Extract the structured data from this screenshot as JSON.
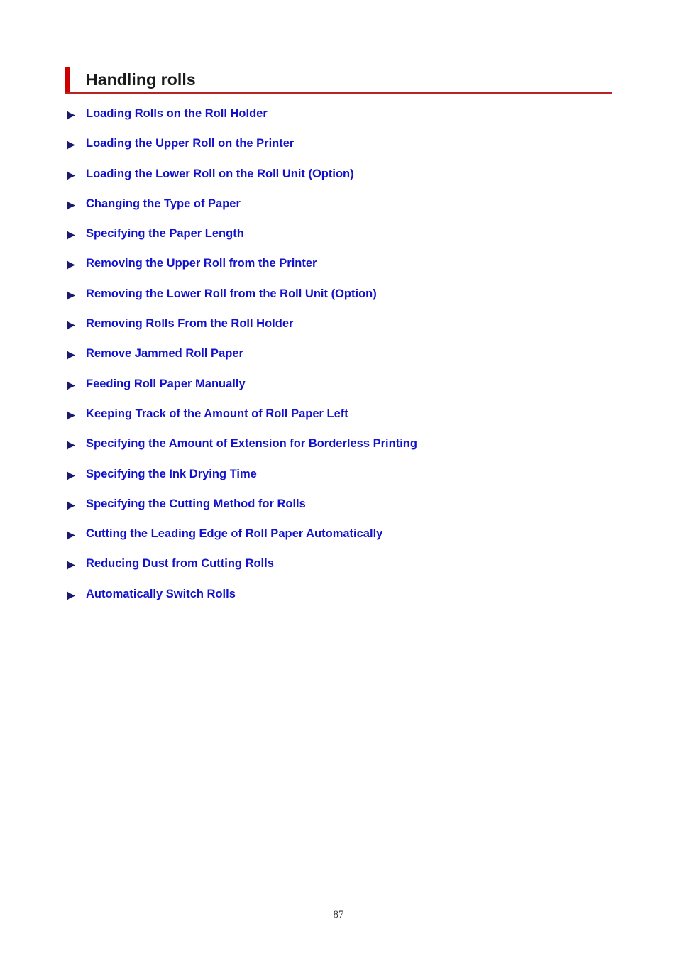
{
  "header": {
    "title": "Handling rolls",
    "accent_color": "#cc0000",
    "rule_color": "#bb2222"
  },
  "colors": {
    "link": "#1212cc",
    "bullet": "#1a1a6e",
    "title_text": "#1a1a1a",
    "background": "#ffffff"
  },
  "list": {
    "bullet_icon": "play-arrow-icon",
    "items": [
      {
        "label": "Loading Rolls on the Roll Holder"
      },
      {
        "label": "Loading the Upper Roll on the Printer"
      },
      {
        "label": "Loading the Lower Roll on the Roll Unit (Option)"
      },
      {
        "label": "Changing the Type of Paper"
      },
      {
        "label": "Specifying the Paper Length"
      },
      {
        "label": "Removing the Upper Roll from the Printer"
      },
      {
        "label": "Removing the Lower Roll from the Roll Unit (Option)"
      },
      {
        "label": "Removing Rolls From the Roll Holder"
      },
      {
        "label": "Remove Jammed Roll Paper"
      },
      {
        "label": "Feeding Roll Paper Manually"
      },
      {
        "label": "Keeping Track of the Amount of Roll Paper Left"
      },
      {
        "label": "Specifying the Amount of Extension for Borderless Printing"
      },
      {
        "label": "Specifying the Ink Drying Time"
      },
      {
        "label": "Specifying the Cutting Method for Rolls"
      },
      {
        "label": "Cutting the Leading Edge of Roll Paper Automatically"
      },
      {
        "label": "Reducing Dust from Cutting Rolls"
      },
      {
        "label": "Automatically Switch Rolls"
      }
    ]
  },
  "footer": {
    "page_number": "87"
  }
}
